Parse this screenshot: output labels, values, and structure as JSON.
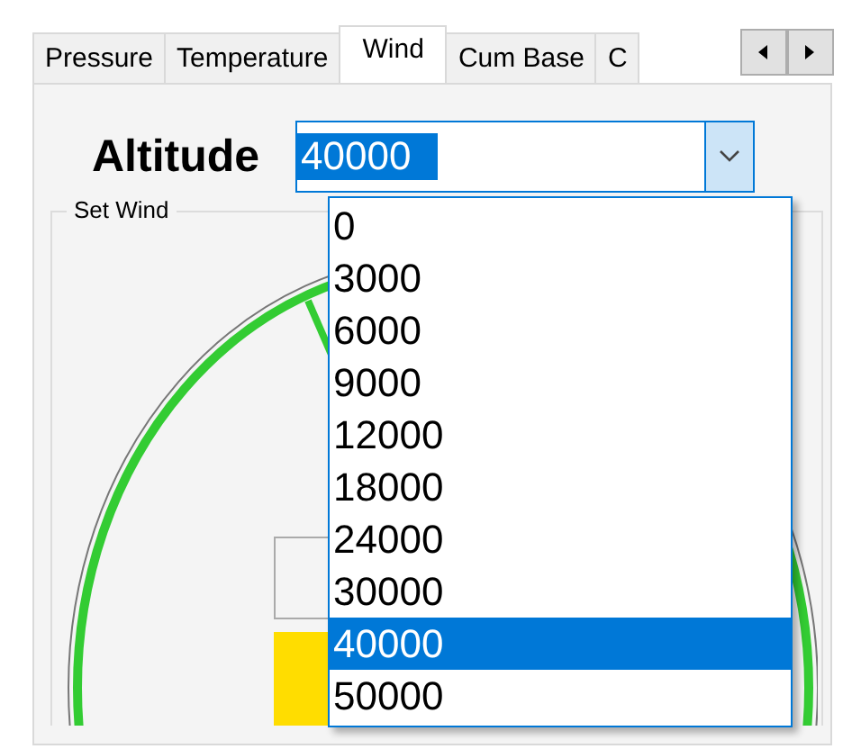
{
  "tabs": [
    {
      "label": "Pressure",
      "selected": false
    },
    {
      "label": "Temperature",
      "selected": false
    },
    {
      "label": "Wind",
      "selected": true
    },
    {
      "label": "Cum Base",
      "selected": false
    },
    {
      "label": "C",
      "selected": false
    }
  ],
  "altitude": {
    "label": "Altitude",
    "value": "40000",
    "open": true,
    "options": [
      {
        "label": "0",
        "selected": false
      },
      {
        "label": "3000",
        "selected": false
      },
      {
        "label": "6000",
        "selected": false
      },
      {
        "label": "9000",
        "selected": false
      },
      {
        "label": "12000",
        "selected": false
      },
      {
        "label": "18000",
        "selected": false
      },
      {
        "label": "24000",
        "selected": false
      },
      {
        "label": "30000",
        "selected": false
      },
      {
        "label": "40000",
        "selected": true
      },
      {
        "label": "50000",
        "selected": false
      }
    ]
  },
  "group": {
    "title": "Set Wind"
  }
}
